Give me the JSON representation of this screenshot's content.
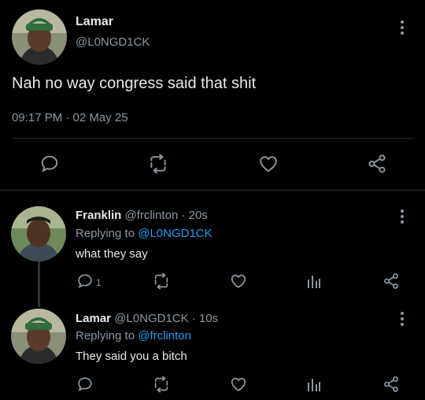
{
  "main_tweet": {
    "author_name": "Lamar",
    "author_handle": "@L0NGD1CK",
    "text": "Nah no way congress said that shit",
    "timestamp": "09:17 PM · 02 May 25"
  },
  "replies": [
    {
      "author_name": "Franklin",
      "meta": "@frclinton · 20s",
      "replying_prefix": "Replying to",
      "replying_to": "@L0NGD1CK",
      "text": "what they say",
      "reply_count": "1"
    },
    {
      "author_name": "Lamar",
      "meta": "@L0NGD1CK · 10s",
      "replying_prefix": "Replying to",
      "replying_to": "@frclinton",
      "text": "They said you a bitch",
      "reply_count": ""
    }
  ],
  "colors": {
    "background": "#000000",
    "text": "#e7e9ea",
    "muted": "#8b98a5",
    "link": "#1d9bf0",
    "divider": "#2f3336"
  },
  "icons": [
    "comment-icon",
    "retweet-icon",
    "like-icon",
    "analytics-icon",
    "share-icon",
    "more-options-icon"
  ]
}
